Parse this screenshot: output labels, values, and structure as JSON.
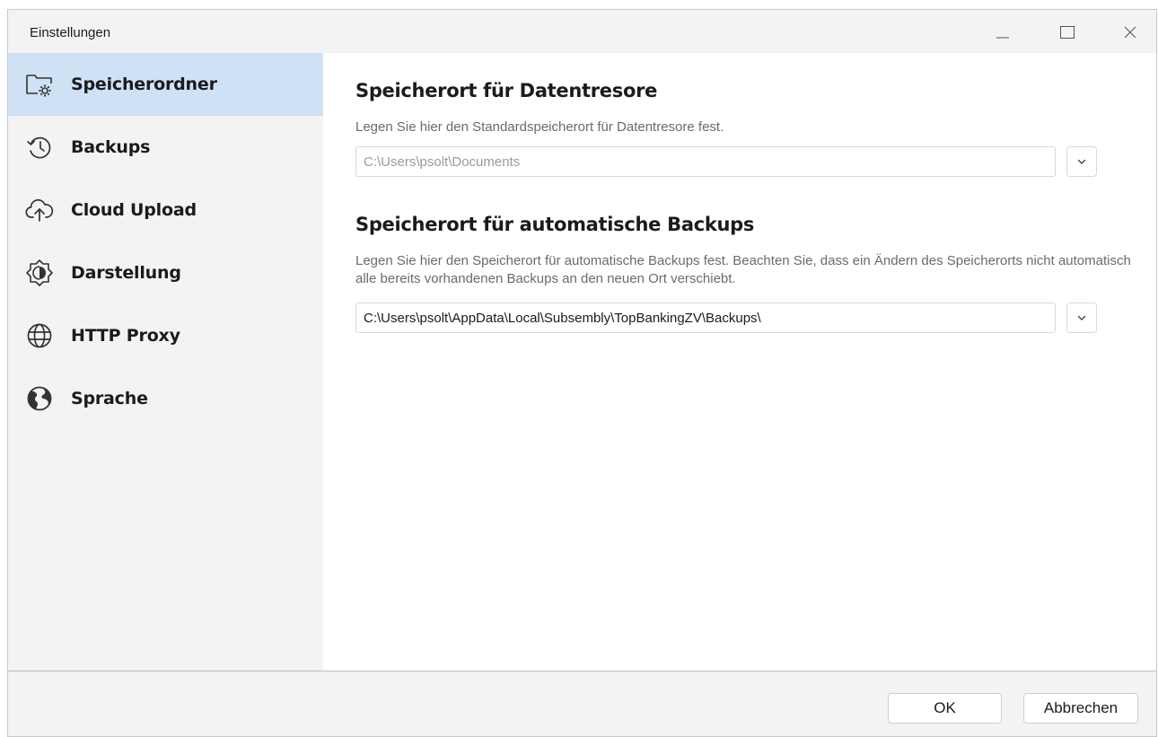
{
  "window": {
    "title": "Einstellungen",
    "controls": {
      "minimize": "minimize-icon",
      "maximize": "maximize-icon",
      "close": "close-icon"
    }
  },
  "sidebar": {
    "items": [
      {
        "label": "Speicherordner",
        "icon": "folder-settings-icon",
        "selected": true
      },
      {
        "label": "Backups",
        "icon": "history-icon",
        "selected": false
      },
      {
        "label": "Cloud Upload",
        "icon": "cloud-upload-icon",
        "selected": false
      },
      {
        "label": "Darstellung",
        "icon": "brightness-icon",
        "selected": false
      },
      {
        "label": "HTTP Proxy",
        "icon": "globe-icon",
        "selected": false
      },
      {
        "label": "Sprache",
        "icon": "earth-icon",
        "selected": false
      }
    ]
  },
  "main": {
    "vault_section": {
      "title": "Speicherort für Datentresore",
      "description": "Legen Sie hier den Standardspeicherort für Datentresore fest.",
      "path_value": "C:\\Users\\psolt\\Documents"
    },
    "backup_section": {
      "title": "Speicherort für automatische Backups",
      "description": "Legen Sie hier den Speicherort für automatische Backups fest. Beachten Sie, dass ein Ändern des Speicherorts nicht automatisch alle bereits vorhandenen Backups an den neuen Ort verschiebt.",
      "path_value": "C:\\Users\\psolt\\AppData\\Local\\Subsembly\\TopBankingZV\\Backups\\"
    }
  },
  "footer": {
    "ok_label": "OK",
    "cancel_label": "Abbrechen"
  },
  "colors": {
    "selected_nav_bg": "#cfe1f4",
    "window_bg": "#f3f3f3",
    "content_bg": "#ffffff"
  }
}
